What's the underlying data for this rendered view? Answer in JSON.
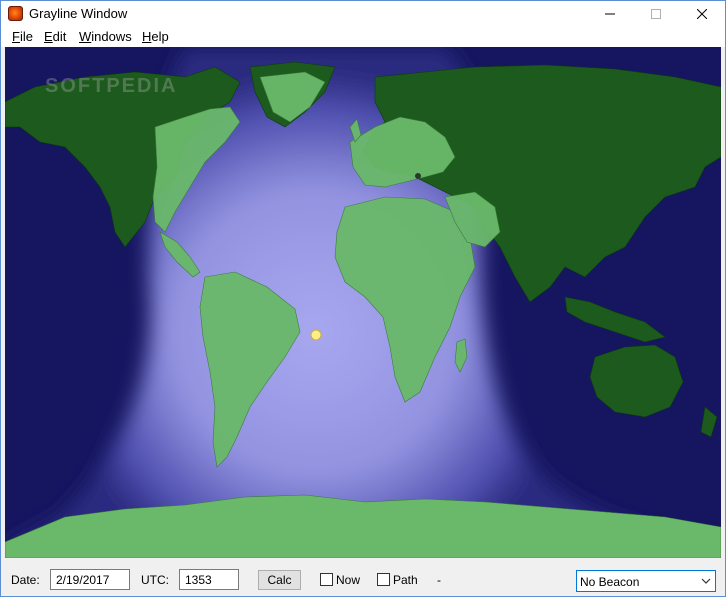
{
  "window": {
    "title": "Grayline Window"
  },
  "watermark": "SOFTPEDIA",
  "menu": {
    "items": [
      {
        "prefix": "",
        "accel": "F",
        "rest": "ile"
      },
      {
        "prefix": "",
        "accel": "E",
        "rest": "dit"
      },
      {
        "prefix": "",
        "accel": "W",
        "rest": "indows"
      },
      {
        "prefix": "",
        "accel": "H",
        "rest": "elp"
      }
    ]
  },
  "icons": {
    "app": "app-globe-icon",
    "minimize": "minimize-icon",
    "maximize": "maximize-icon",
    "close": "close-icon",
    "dropdown": "chevron-down-icon",
    "sun": "sun-marker-icon"
  },
  "colors": {
    "ocean_night": "#151560",
    "land": "#1a5a1a",
    "daylight": "#a5a5ee",
    "sun": "#ffee88"
  },
  "controls": {
    "date_label": "Date:",
    "date_value": "2/19/2017",
    "utc_label": "UTC:",
    "utc_value": "1353",
    "calc_label": "Calc",
    "now_label": "Now",
    "now_checked": false,
    "path_label": "Path",
    "path_checked": false,
    "separator": "-",
    "beacon_value": "No Beacon"
  }
}
